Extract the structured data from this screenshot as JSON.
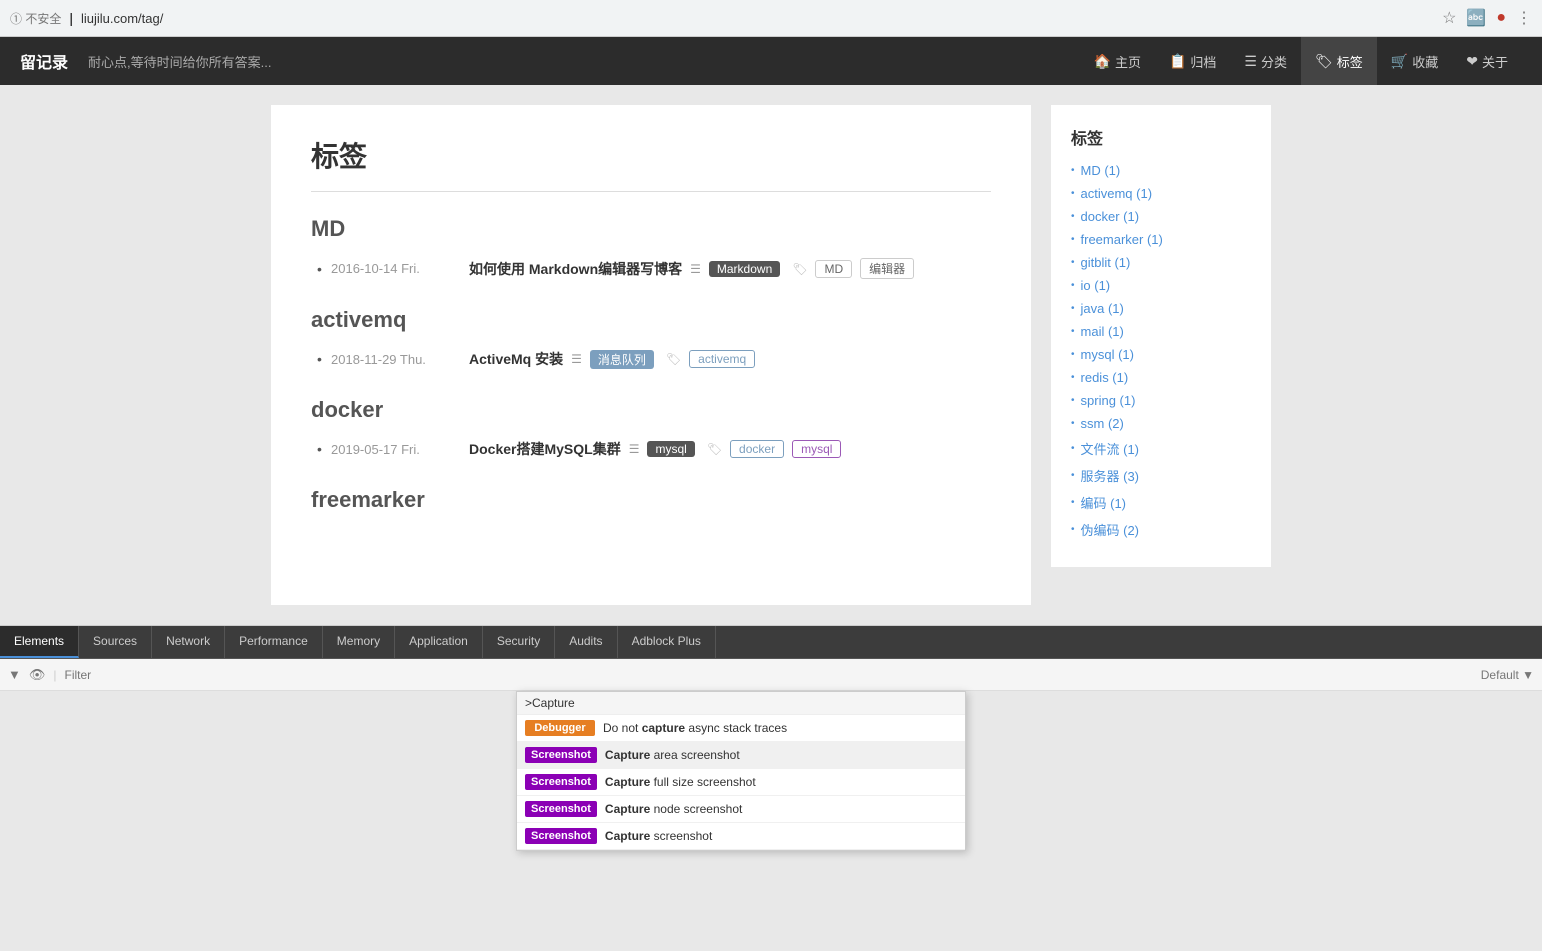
{
  "browser": {
    "security_label": "① 不安全",
    "url": "liujilu.com/tag/",
    "separator": "|"
  },
  "nav": {
    "logo": "留记录",
    "tagline": "耐心点,等待时间给你所有答案...",
    "items": [
      {
        "id": "home",
        "icon": "🏠",
        "label": "主页"
      },
      {
        "id": "archive",
        "icon": "📋",
        "label": "归档"
      },
      {
        "id": "category",
        "icon": "☰",
        "label": "分类"
      },
      {
        "id": "tag",
        "icon": "🏷",
        "label": "标签",
        "active": true
      },
      {
        "id": "collect",
        "icon": "🛒",
        "label": "收藏"
      },
      {
        "id": "about",
        "icon": "❤",
        "label": "关于"
      }
    ]
  },
  "page": {
    "title": "标签",
    "sections": [
      {
        "id": "md",
        "title": "MD",
        "posts": [
          {
            "date": "2016-10-14 Fri.",
            "title": "如何使用 Markdown编辑器写博客",
            "category_badge": "Markdown",
            "tags": [
              "MD",
              "编辑器"
            ]
          }
        ]
      },
      {
        "id": "activemq",
        "title": "activemq",
        "posts": [
          {
            "date": "2018-11-29 Thu.",
            "title": "ActiveMq 安装",
            "category_badge": "消息队列",
            "tags": [
              "activemq"
            ]
          }
        ]
      },
      {
        "id": "docker",
        "title": "docker",
        "posts": [
          {
            "date": "2019-05-17 Fri.",
            "title": "Docker搭建MySQL集群",
            "category_badge": "mysql",
            "tags": [
              "docker",
              "mysql"
            ]
          }
        ]
      },
      {
        "id": "freemarker",
        "title": "freemarker",
        "posts": []
      }
    ]
  },
  "sidebar": {
    "title": "标签",
    "items": [
      {
        "label": "MD (1)",
        "href": "#md"
      },
      {
        "label": "activemq (1)",
        "href": "#activemq"
      },
      {
        "label": "docker (1)",
        "href": "#docker"
      },
      {
        "label": "freemarker (1)",
        "href": "#freemarker"
      },
      {
        "label": "gitblit (1)",
        "href": "#gitblit"
      },
      {
        "label": "io (1)",
        "href": "#io"
      },
      {
        "label": "java (1)",
        "href": "#java"
      },
      {
        "label": "mail (1)",
        "href": "#mail"
      },
      {
        "label": "mysql (1)",
        "href": "#mysql"
      },
      {
        "label": "redis (1)",
        "href": "#redis"
      },
      {
        "label": "spring (1)",
        "href": "#spring"
      },
      {
        "label": "ssm (2)",
        "href": "#ssm"
      },
      {
        "label": "文件流 (1)",
        "href": "#wjl"
      },
      {
        "label": "服务器 (3)",
        "href": "#fwq"
      },
      {
        "label": "编码 (1)",
        "href": "#bm"
      },
      {
        "label": "伪编码 (2)",
        "href": "#wbm"
      }
    ]
  },
  "devtools": {
    "tabs": [
      "Elements",
      "Sources",
      "Network",
      "Performance",
      "Memory",
      "Application",
      "Security",
      "Audits",
      "Adblock Plus"
    ],
    "active_tab": "Elements",
    "filter_placeholder": "Filter",
    "default_label": "Default ▼",
    "toolbar_icons": [
      "▼",
      "👁"
    ]
  },
  "autocomplete": {
    "header": ">Capture",
    "items": [
      {
        "badge_type": "debugger",
        "badge_label": "Debugger",
        "text_before": "Do not ",
        "text_bold": "capture",
        "text_after": " async stack traces"
      },
      {
        "badge_type": "screenshot",
        "badge_label": "Screenshot",
        "text_before": "",
        "text_bold": "Capture",
        "text_after": " area screenshot",
        "highlighted": true
      },
      {
        "badge_type": "screenshot",
        "badge_label": "Screenshot",
        "text_before": "",
        "text_bold": "Capture",
        "text_after": " full size screenshot"
      },
      {
        "badge_type": "screenshot",
        "badge_label": "Screenshot",
        "text_before": "",
        "text_bold": "Capture",
        "text_after": " node screenshot"
      },
      {
        "badge_type": "screenshot",
        "badge_label": "Screenshot",
        "text_before": "",
        "text_bold": "Capture",
        "text_after": " screenshot"
      }
    ]
  }
}
